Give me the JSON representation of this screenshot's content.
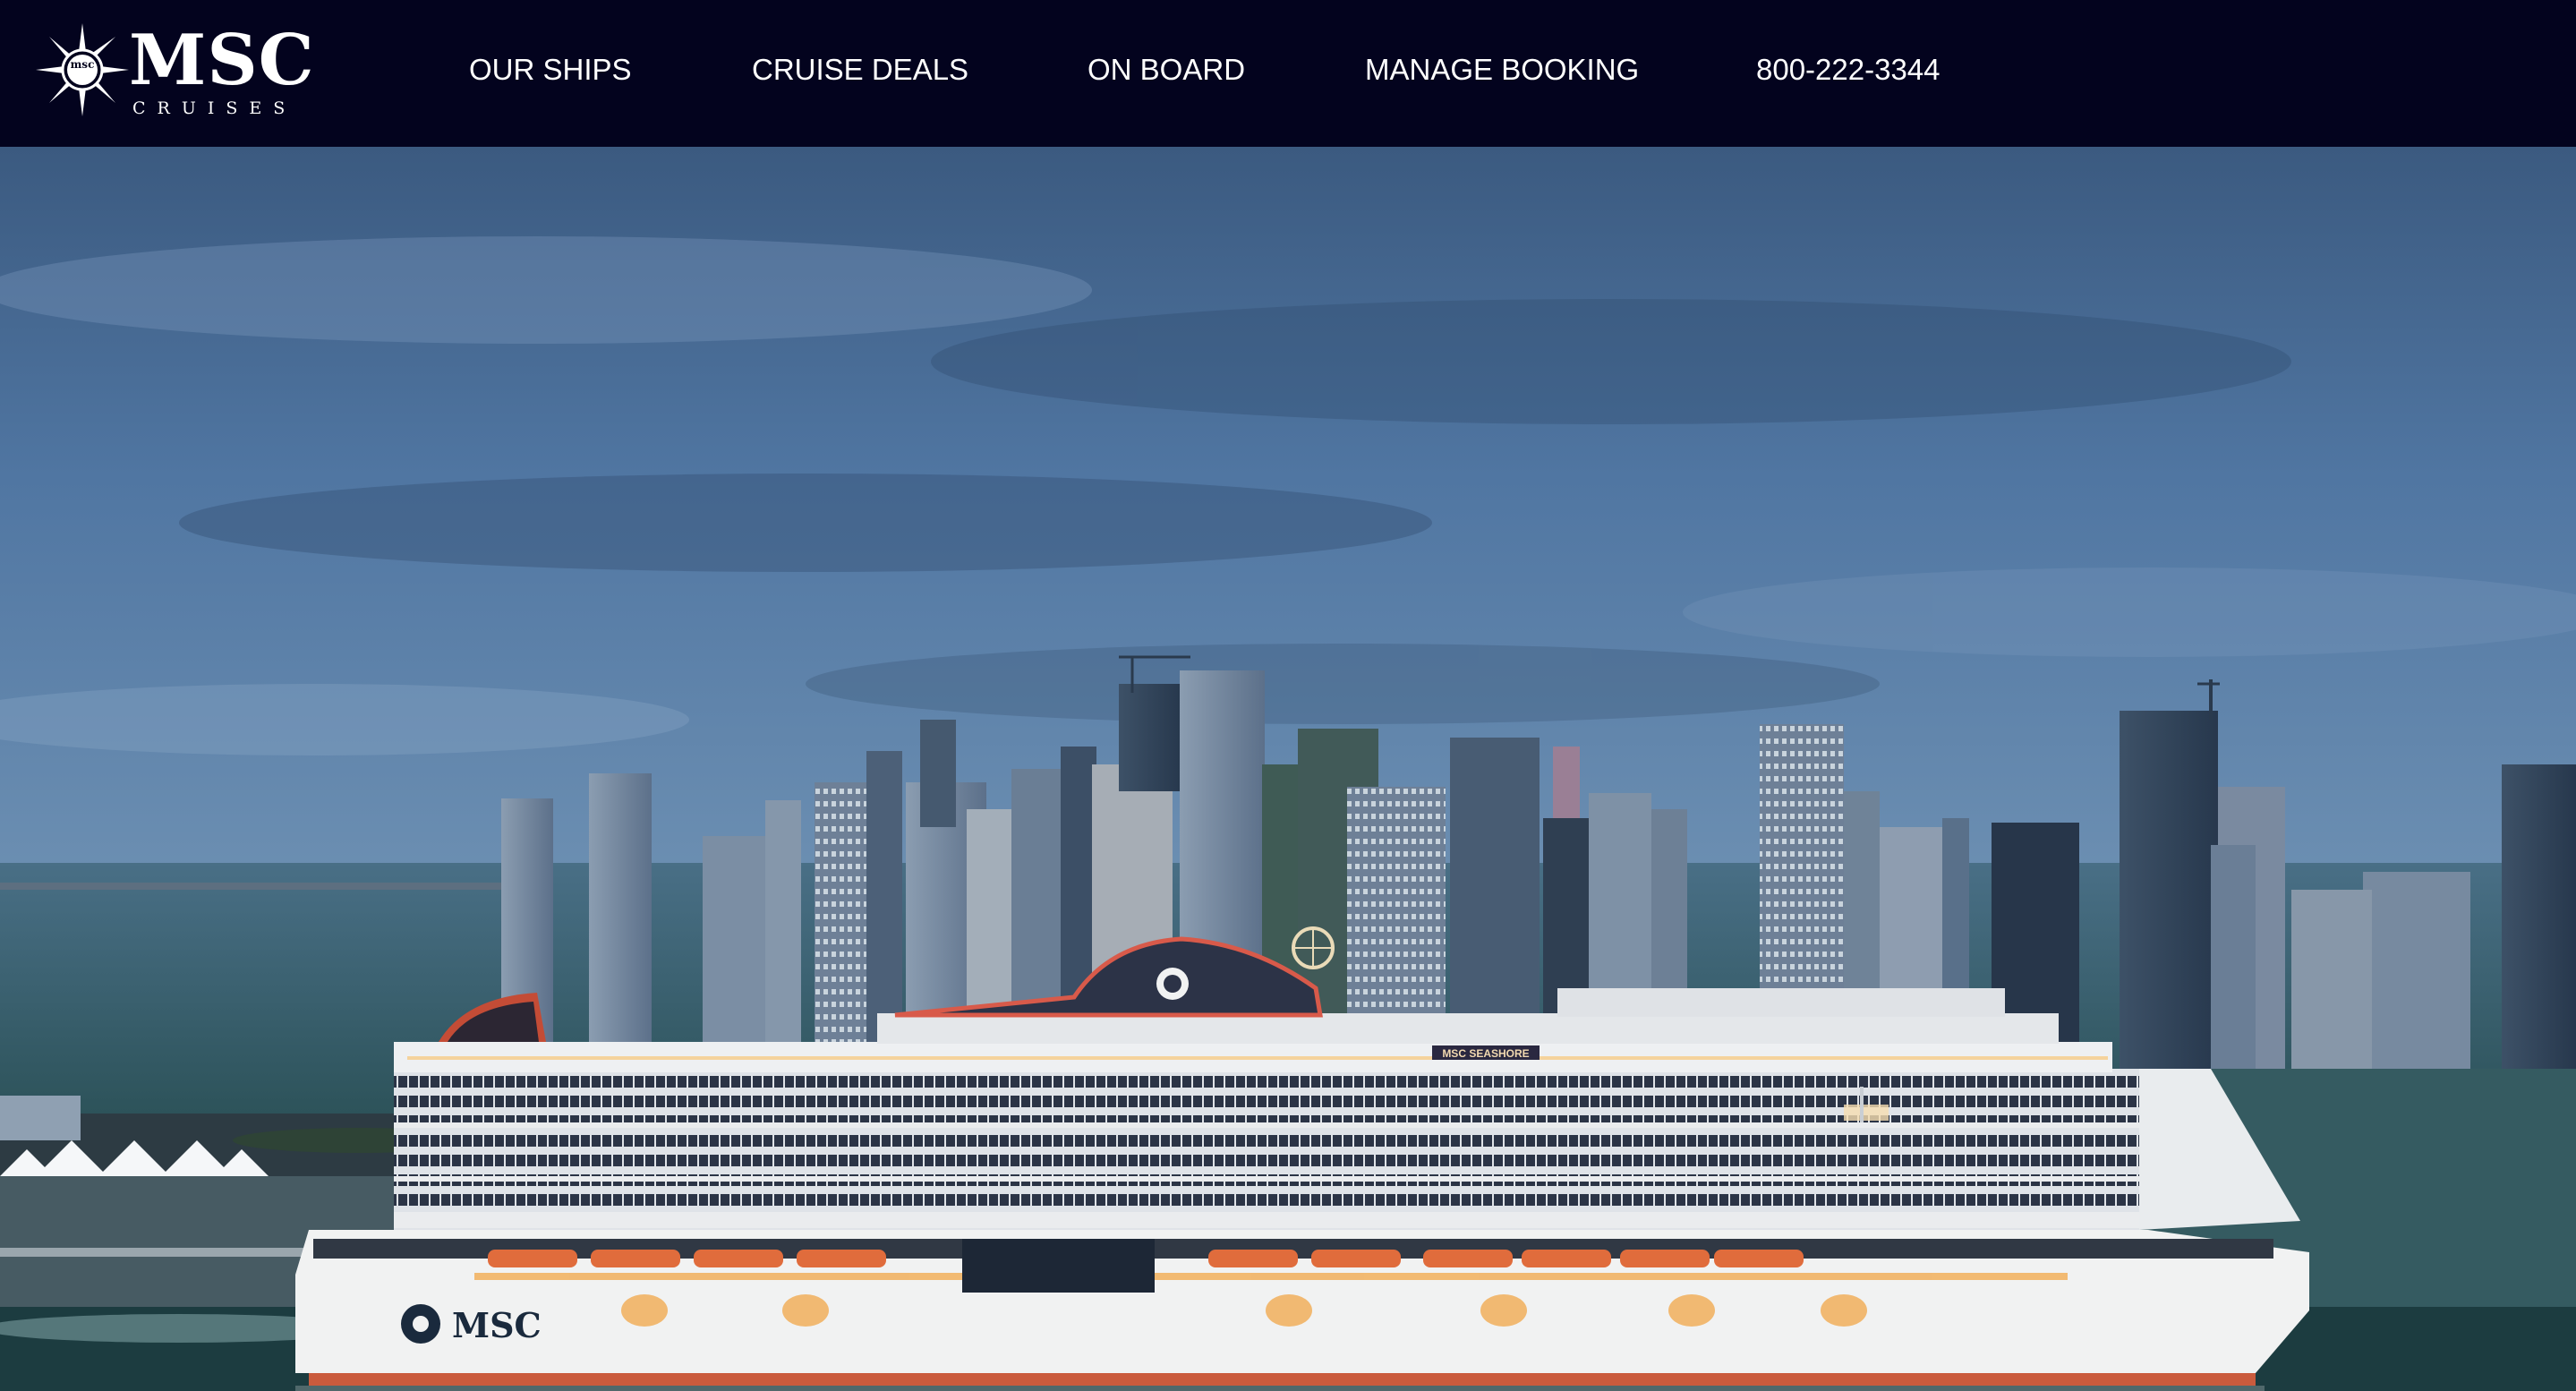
{
  "brand": {
    "name": "MSC",
    "tagline": "CRUISES",
    "emblem_text": "msc",
    "logo_icon": "compass-rose-icon"
  },
  "nav": {
    "items": [
      {
        "label": "OUR SHIPS"
      },
      {
        "label": "CRUISE DEALS"
      },
      {
        "label": "ON BOARD"
      },
      {
        "label": "MANAGE BOOKING"
      },
      {
        "label": "800-222-3344"
      }
    ]
  },
  "hero": {
    "ship_hull_text": "MSC",
    "ship_name_sign": "MSC SEASHORE"
  },
  "colors": {
    "nav_background": "#03031e",
    "nav_text": "#ffffff",
    "sky_top": "#3a5a80",
    "sea": "#355f66",
    "hull": "#f1f2f2",
    "accent_lights": "#f2b05c"
  }
}
